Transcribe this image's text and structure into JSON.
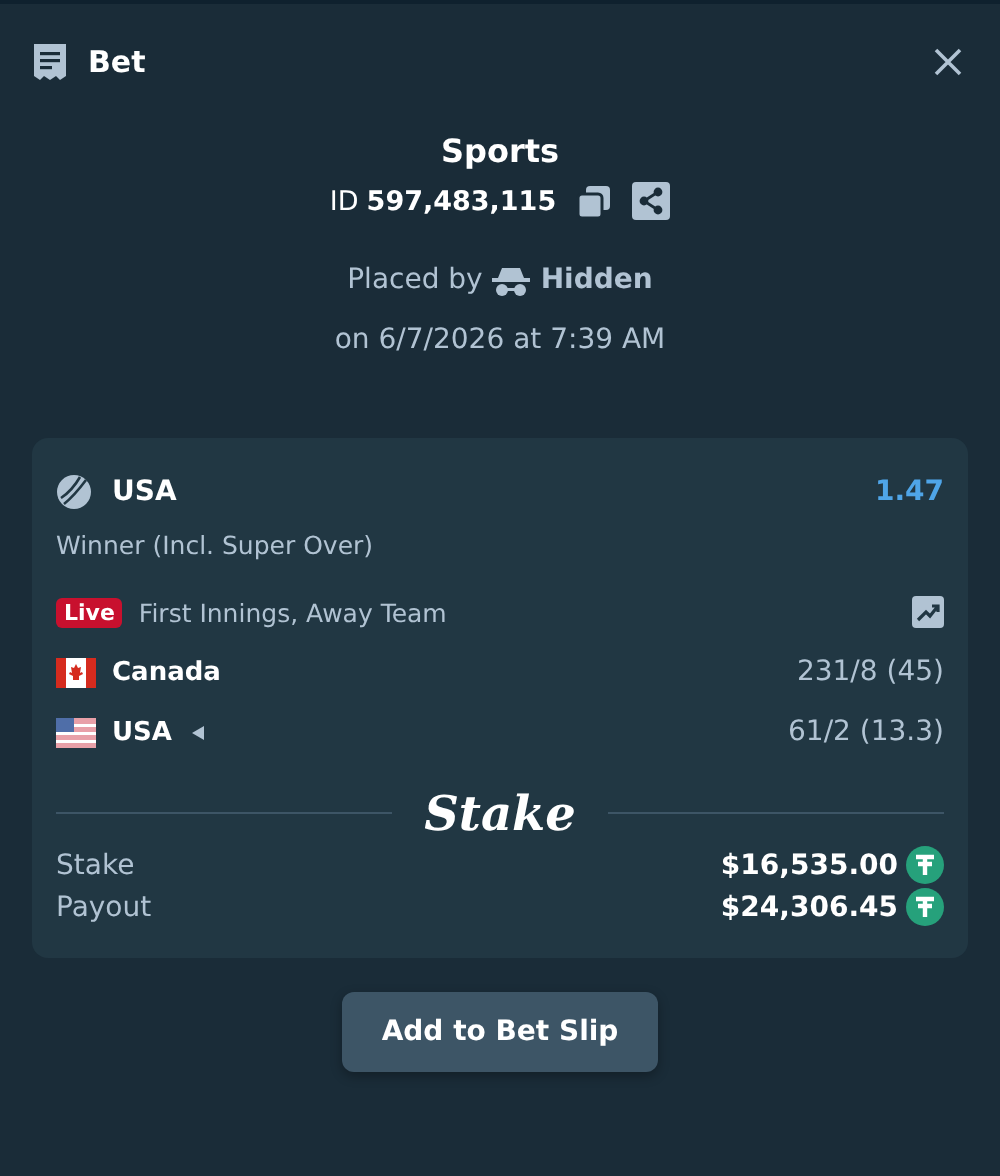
{
  "header": {
    "title": "Bet"
  },
  "summary": {
    "category": "Sports",
    "id_prefix": "ID",
    "id": "597,483,115",
    "placed_by": "Placed by",
    "user": "Hidden",
    "date": "on 6/7/2026 at 7:39 AM"
  },
  "selection": {
    "name": "USA",
    "odds": "1.47",
    "market": "Winner (Incl. Super Over)",
    "live_badge": "Live",
    "status": "First Innings, Away Team",
    "teams": [
      {
        "name": "Canada",
        "kind": "ca",
        "batting": false,
        "score": "231/8 (45)"
      },
      {
        "name": "USA",
        "kind": "us",
        "batting": true,
        "score": "61/2 (13.3)"
      }
    ]
  },
  "brand": "Stake",
  "amounts": [
    {
      "label": "Stake",
      "value": "$16,535.00"
    },
    {
      "label": "Payout",
      "value": "$24,306.45"
    }
  ],
  "button": "Add to Bet Slip"
}
